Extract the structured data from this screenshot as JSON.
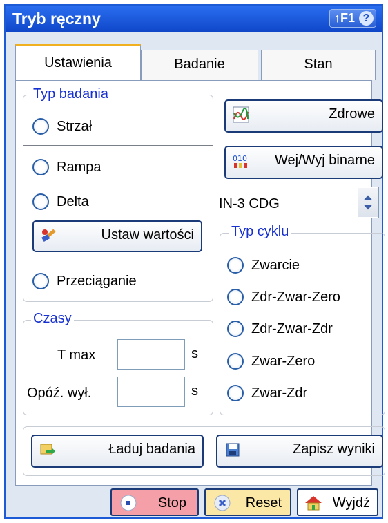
{
  "window": {
    "title": "Tryb ręczny",
    "help_label": "↑F1",
    "help_glyph": "?"
  },
  "tabs": [
    {
      "label": "Ustawienia",
      "active": true
    },
    {
      "label": "Badanie",
      "active": false
    },
    {
      "label": "Stan",
      "active": false
    }
  ],
  "test_type": {
    "legend": "Typ badania",
    "options": [
      "Strzał",
      "Rampa",
      "Delta",
      "Przeciąganie"
    ],
    "set_values_button": "Ustaw wartości"
  },
  "times": {
    "legend": "Czasy",
    "tmax_label": "T max",
    "tmax_unit": "s",
    "delay_label": "Opóź. wył.",
    "delay_unit": "s"
  },
  "right": {
    "healthy_button": "Zdrowe",
    "io_button": "Wej/Wyj binarne",
    "in3_label": "IN-3 CDG"
  },
  "cycle_type": {
    "legend": "Typ cyklu",
    "options": [
      "Zwarcie",
      "Zdr-Zwar-Zero",
      "Zdr-Zwar-Zdr",
      "Zwar-Zero",
      "Zwar-Zdr"
    ]
  },
  "actions": {
    "load_button": "Ładuj badania",
    "save_button": "Zapisz wyniki"
  },
  "bottom": {
    "stop": "Stop",
    "reset": "Reset",
    "exit": "Wyjdź"
  },
  "colors": {
    "title_bar": "#1e5ae0",
    "legend_text": "#1730d0",
    "stop_bg": "#f5a0a8",
    "reset_bg": "#fbe7a6"
  }
}
